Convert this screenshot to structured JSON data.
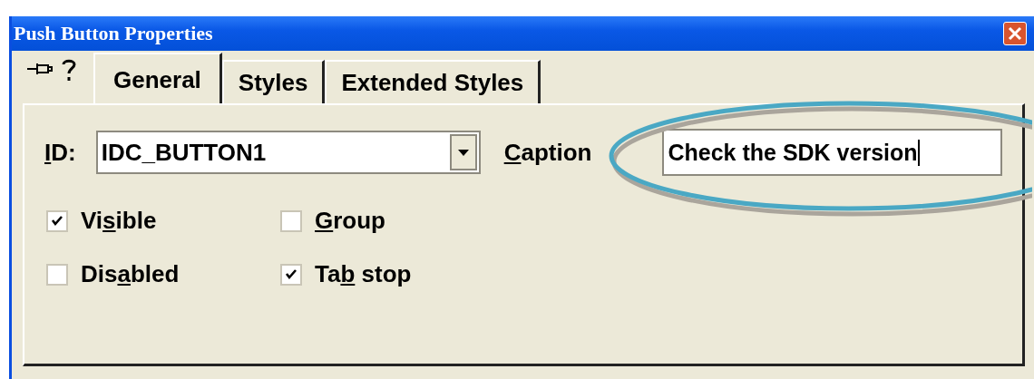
{
  "window": {
    "title": "Push Button Properties"
  },
  "tabs": [
    {
      "label": "General",
      "selected": true
    },
    {
      "label": "Styles",
      "selected": false
    },
    {
      "label": "Extended Styles",
      "selected": false
    }
  ],
  "id_field": {
    "label": {
      "key": "I",
      "post": "D:"
    },
    "value": "IDC_BUTTON1"
  },
  "caption_field": {
    "label": {
      "key": "C",
      "post": "aption"
    },
    "value": "Check the SDK version",
    "focused": true
  },
  "checkboxes": [
    {
      "label": {
        "pre": "Vi",
        "key": "s",
        "post": "ible"
      },
      "checked": true
    },
    {
      "label": {
        "key": "G",
        "post": "roup"
      },
      "checked": false
    },
    {
      "label": {
        "pre": "Dis",
        "key": "a",
        "post": "bled"
      },
      "checked": false
    },
    {
      "label": {
        "pre": "Ta",
        "key": "b",
        "post": " stop"
      },
      "checked": true
    }
  ],
  "annotation": {
    "kind": "ellipse"
  }
}
